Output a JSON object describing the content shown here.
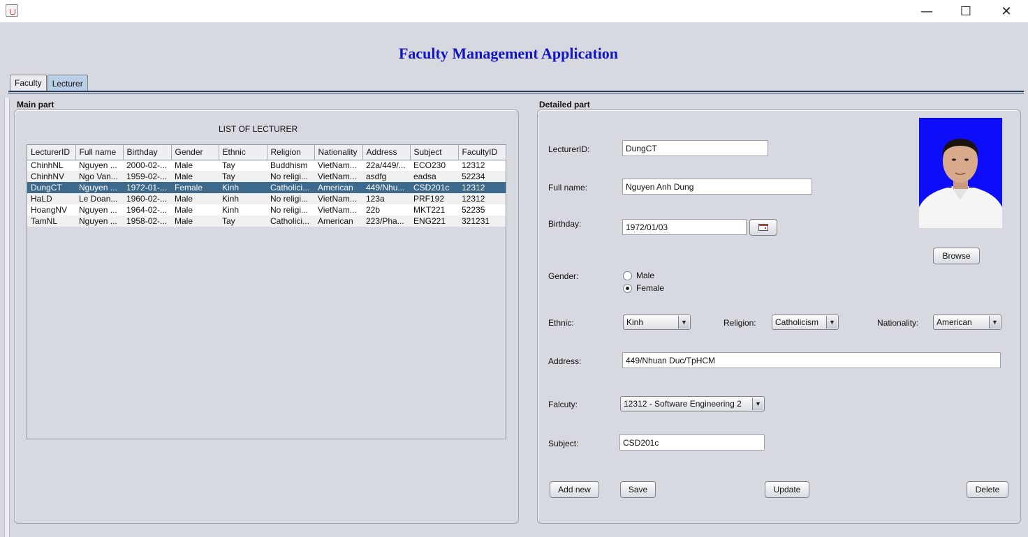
{
  "window": {
    "min": "—",
    "max": "☐",
    "close": "✕"
  },
  "title": "Faculty Management Application",
  "tabs": [
    {
      "label": "Faculty"
    },
    {
      "label": "Lecturer"
    }
  ],
  "main_part": {
    "label": "Main part",
    "caption": "LIST OF LECTURER",
    "columns": [
      "LecturerID",
      "Full name",
      "Birthday",
      "Gender",
      "Ethnic",
      "Religion",
      "Nationality",
      "Address",
      "Subject",
      "FacultyID"
    ],
    "rows": [
      [
        "ChinhNL",
        "Nguyen ...",
        "2000-02-...",
        "Male",
        "Tay",
        "Buddhism",
        "VietNam...",
        "22a/449/...",
        "ECO230",
        "12312"
      ],
      [
        "ChinhNV",
        "Ngo Van...",
        "1959-02-...",
        "Male",
        "Tay",
        "No religi...",
        "VietNam...",
        "asdfg",
        "eadsa",
        "52234"
      ],
      [
        "DungCT",
        "Nguyen ...",
        "1972-01-...",
        "Female",
        "Kinh",
        "Catholici...",
        "American",
        "449/Nhu...",
        "CSD201c",
        "12312"
      ],
      [
        "HaLD",
        "Le Doan...",
        "1960-02-...",
        "Male",
        "Kinh",
        "No religi...",
        "VietNam...",
        "123a",
        "PRF192",
        "12312"
      ],
      [
        "HoangNV",
        "Nguyen ...",
        "1964-02-...",
        "Male",
        "Kinh",
        "No religi...",
        "VietNam...",
        "22b",
        "MKT221",
        "52235"
      ],
      [
        "TamNL",
        "Nguyen ...",
        "1958-02-...",
        "Male",
        "Tay",
        "Catholici...",
        "American",
        "223/Pha...",
        "ENG221",
        "321231"
      ]
    ]
  },
  "detail": {
    "label": "Detailed part",
    "lecturer_id_label": "LecturerID:",
    "lecturer_id": "DungCT",
    "fullname_label": "Full name:",
    "fullname": "Nguyen Anh Dung",
    "birthday_label": "Birthday:",
    "birthday": "1972/01/03",
    "browse": "Browse",
    "gender_label": "Gender:",
    "male": "Male",
    "female": "Female",
    "ethnic_label": "Ethnic:",
    "ethnic": "Kinh",
    "religion_label": "Religion:",
    "religion": "Catholicism",
    "nationality_label": "Nationality:",
    "nationality": "American",
    "address_label": "Address:",
    "address": "449/Nhuan Duc/TpHCM",
    "faculty_label": "Falcuty:",
    "faculty": "12312 - Software Engineering 2",
    "subject_label": "Subject:",
    "subject": "CSD201c",
    "buttons": {
      "add": "Add new",
      "save": "Save",
      "update": "Update",
      "delete": "Delete"
    }
  }
}
